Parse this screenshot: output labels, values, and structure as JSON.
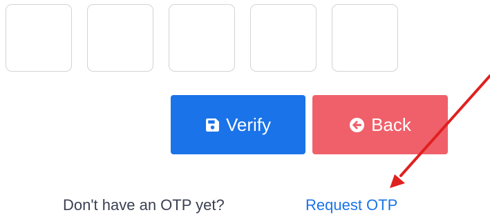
{
  "otp": {
    "digits": [
      "",
      "",
      "",
      "",
      ""
    ]
  },
  "buttons": {
    "verify_label": "Verify",
    "verify_icon": "save-icon",
    "back_label": "Back",
    "back_icon": "circle-arrow-left-icon"
  },
  "footer": {
    "prompt": "Don't have an OTP yet?",
    "request_link": "Request OTP"
  },
  "colors": {
    "primary": "#1a73e8",
    "danger": "#f0606a",
    "annotation": "#e02020",
    "text": "#3a3f51"
  }
}
